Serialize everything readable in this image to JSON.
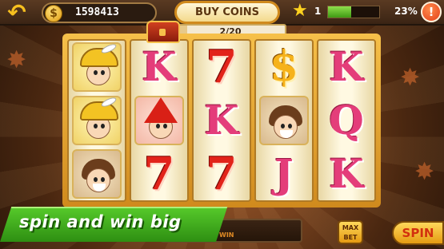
{
  "header": {
    "back_icon": "undo-arrow-icon",
    "coin_icon": "dollar-coin-icon",
    "coin_symbol": "$",
    "coin_balance": "1598413",
    "buy_coins_label": "BUY COINS",
    "level": "1",
    "xp_fraction": 0.45,
    "xp_percent_text": "23%",
    "alert_label": "!"
  },
  "bonus_progress": {
    "chest_icon": "treasure-chest-icon",
    "text": "2/20",
    "current": 2,
    "total": 20
  },
  "reels": [
    [
      {
        "type": "card",
        "style": "gold",
        "icon": "musketeer-gold-hat-icon"
      },
      {
        "type": "card",
        "style": "gold",
        "icon": "musketeer-gold-hat-icon"
      },
      {
        "type": "card",
        "style": "brown",
        "icon": "bearded-man-icon"
      }
    ],
    [
      {
        "type": "letter",
        "text": "K"
      },
      {
        "type": "card",
        "style": "red",
        "icon": "red-wizard-icon"
      },
      {
        "type": "seven",
        "text": "7"
      }
    ],
    [
      {
        "type": "seven",
        "text": "7"
      },
      {
        "type": "letter",
        "text": "K"
      },
      {
        "type": "seven",
        "text": "7"
      }
    ],
    [
      {
        "type": "dollar",
        "text": "$"
      },
      {
        "type": "card",
        "style": "brown",
        "icon": "bearded-man-icon"
      },
      {
        "type": "letter",
        "text": "J"
      }
    ],
    [
      {
        "type": "letter",
        "text": "K"
      },
      {
        "type": "letter",
        "text": "Q"
      },
      {
        "type": "letter",
        "text": "K"
      }
    ]
  ],
  "footer": {
    "banner_text": "spin and win big",
    "win_label": "WIN",
    "max_bet_line1": "MAX",
    "max_bet_line2": "BET",
    "spin_label": "SPIN"
  }
}
